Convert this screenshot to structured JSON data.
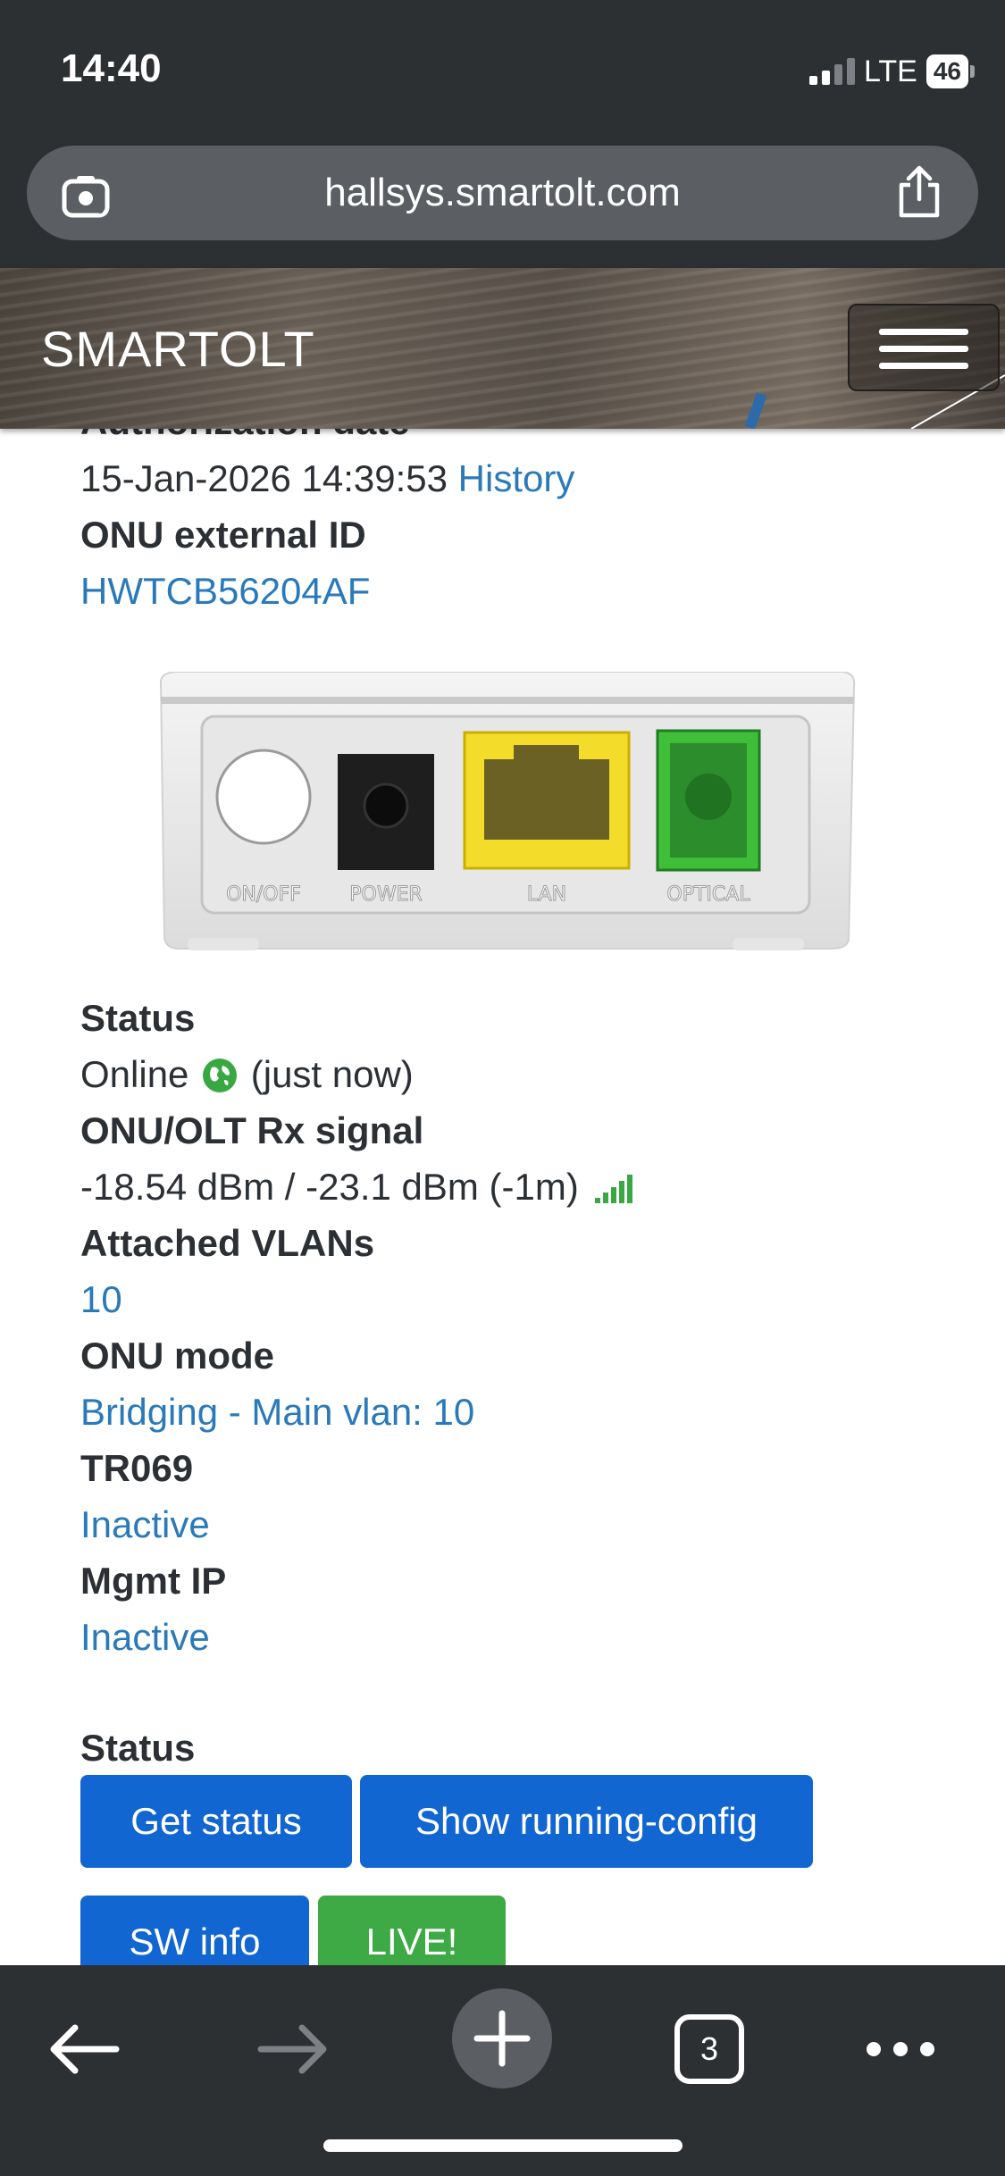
{
  "status_bar": {
    "time": "14:40",
    "network": "LTE",
    "battery": "46"
  },
  "browser": {
    "url": "hallsys.smartolt.com",
    "tab_count": "3"
  },
  "site": {
    "logo": "SMARTOLT"
  },
  "details": {
    "cut_off_label": "Authorization date",
    "authorization_date": "15-Jan-2026 14:39:53",
    "history_link": "History",
    "external_id_label": "ONU external ID",
    "external_id": "HWTCB56204AF",
    "device_ports": [
      "ON/OFF",
      "POWER",
      "LAN",
      "OPTICAL"
    ],
    "status_label": "Status",
    "status_value": "Online",
    "status_time": "(just now)",
    "signal_label": "ONU/OLT Rx signal",
    "signal_value": "-18.54 dBm / -23.1 dBm (-1m)",
    "vlans_label": "Attached VLANs",
    "vlans_value": "10",
    "mode_label": "ONU mode",
    "mode_value": "Bridging - Main vlan: 10",
    "tr069_label": "TR069",
    "tr069_value": "Inactive",
    "mgmt_label": "Mgmt IP",
    "mgmt_value": "Inactive"
  },
  "actions": {
    "section_label": "Status",
    "get_status": "Get status",
    "show_running_config": "Show running-config",
    "sw_info": "SW info",
    "live": "LIVE!"
  },
  "colors": {
    "link": "#2a7ab9",
    "button_blue": "#1266d2",
    "button_green": "#3eaa45",
    "online_green": "#3aa842"
  }
}
